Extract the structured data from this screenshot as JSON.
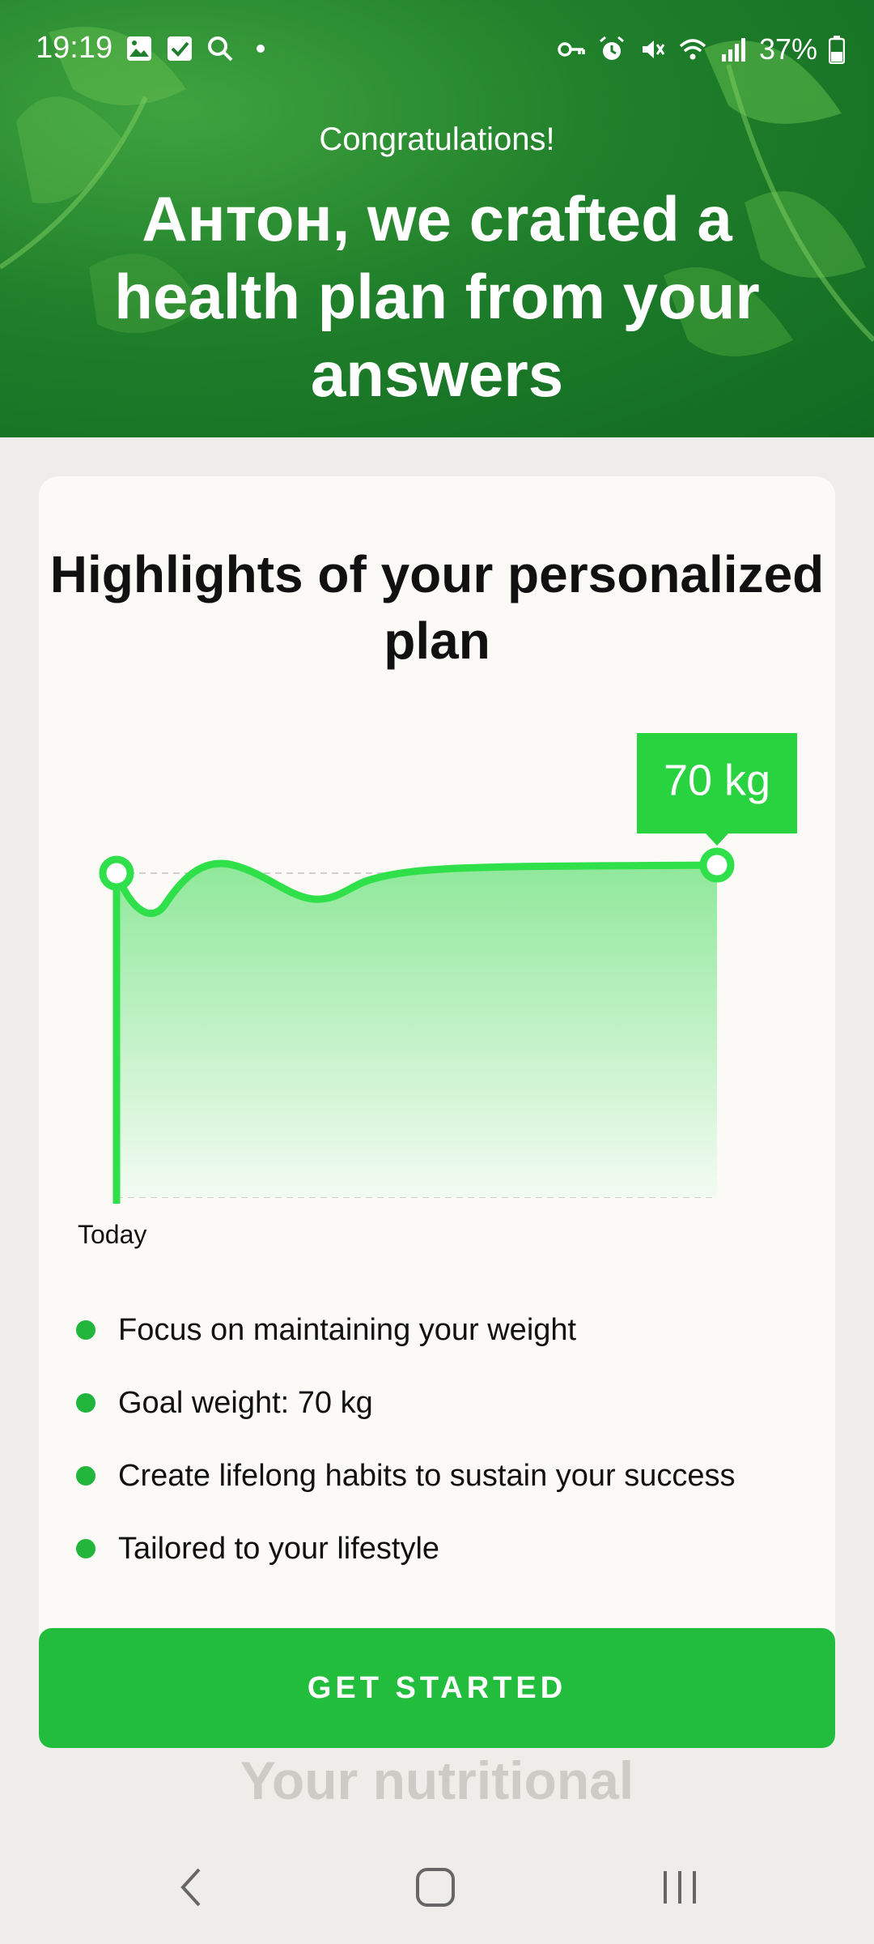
{
  "status_bar": {
    "time": "19:19",
    "battery": "37%",
    "left_icons": [
      "image-icon",
      "checkbox-icon",
      "search-icon",
      "dot-icon"
    ],
    "right_icons": [
      "key-icon",
      "alarm-icon",
      "mute-icon",
      "wifi-icon",
      "signal-icon",
      "battery-icon"
    ]
  },
  "hero": {
    "congrats": "Congratulations!",
    "title": "Антон, we crafted a health plan from your answers"
  },
  "card": {
    "title": "Highlights of your personalized plan",
    "x_label_start": "Today",
    "bullets": [
      "Focus on maintaining your weight",
      "Goal weight: 70 kg",
      "Create lifelong habits to sustain your success",
      "Tailored to your lifestyle"
    ]
  },
  "chart_data": {
    "type": "area",
    "end_label": "70 kg",
    "x_start_label": "Today",
    "colors": {
      "line": "#2fe04a",
      "fill_top": "#8fe89a",
      "fill_bottom": "#f3fbf2",
      "badge": "#28d33f"
    }
  },
  "cta": {
    "label": "GET STARTED",
    "color": "#22bd3c"
  },
  "peek_text": "Your nutritional",
  "navbar": {
    "icons": [
      "back-icon",
      "home-icon",
      "recents-icon"
    ]
  }
}
